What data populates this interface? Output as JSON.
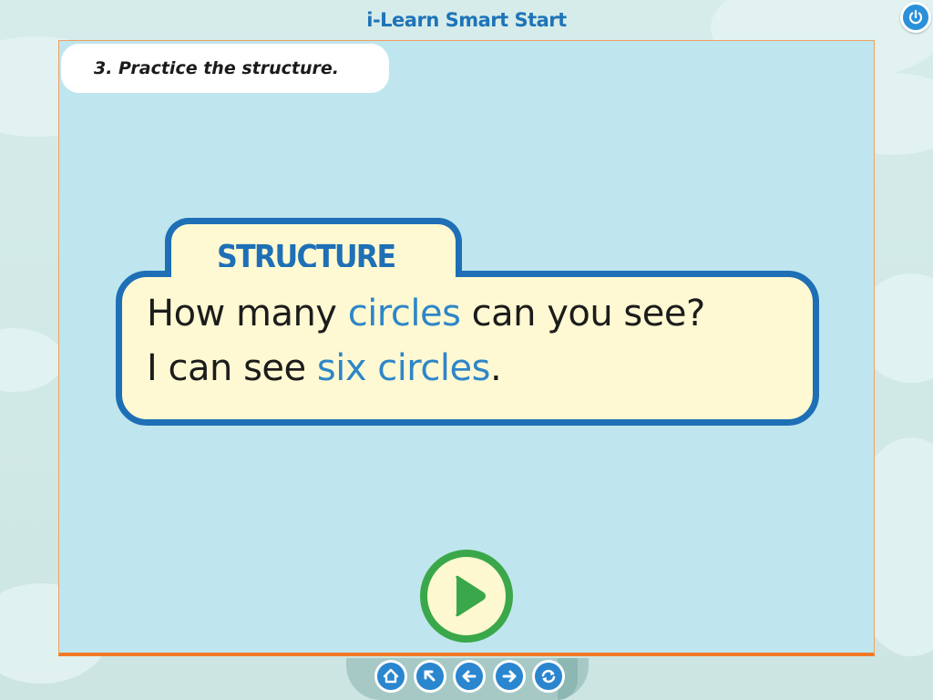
{
  "app": {
    "title": "i-Learn Smart Start"
  },
  "instruction": {
    "text": "3. Practice the structure."
  },
  "structure": {
    "label": "STRUCTURE",
    "line1": {
      "before": "How many ",
      "highlight": "circles",
      "after": " can you see?"
    },
    "line2": {
      "before": "I can see ",
      "highlight": "six circles",
      "after": "."
    }
  },
  "icons": {
    "power": "power-icon",
    "play": "play-icon",
    "nav": [
      "home-icon",
      "arrow-up-left-icon",
      "arrow-left-icon",
      "arrow-right-icon",
      "refresh-icon"
    ]
  },
  "colors": {
    "accent_blue": "#1e6fb6",
    "highlight_blue": "#2f86c8",
    "stage_bg": "#bfe6ee",
    "card_bg": "#fef9d2",
    "play_green": "#3aa84a",
    "stage_border_orange": "#f07a28"
  }
}
